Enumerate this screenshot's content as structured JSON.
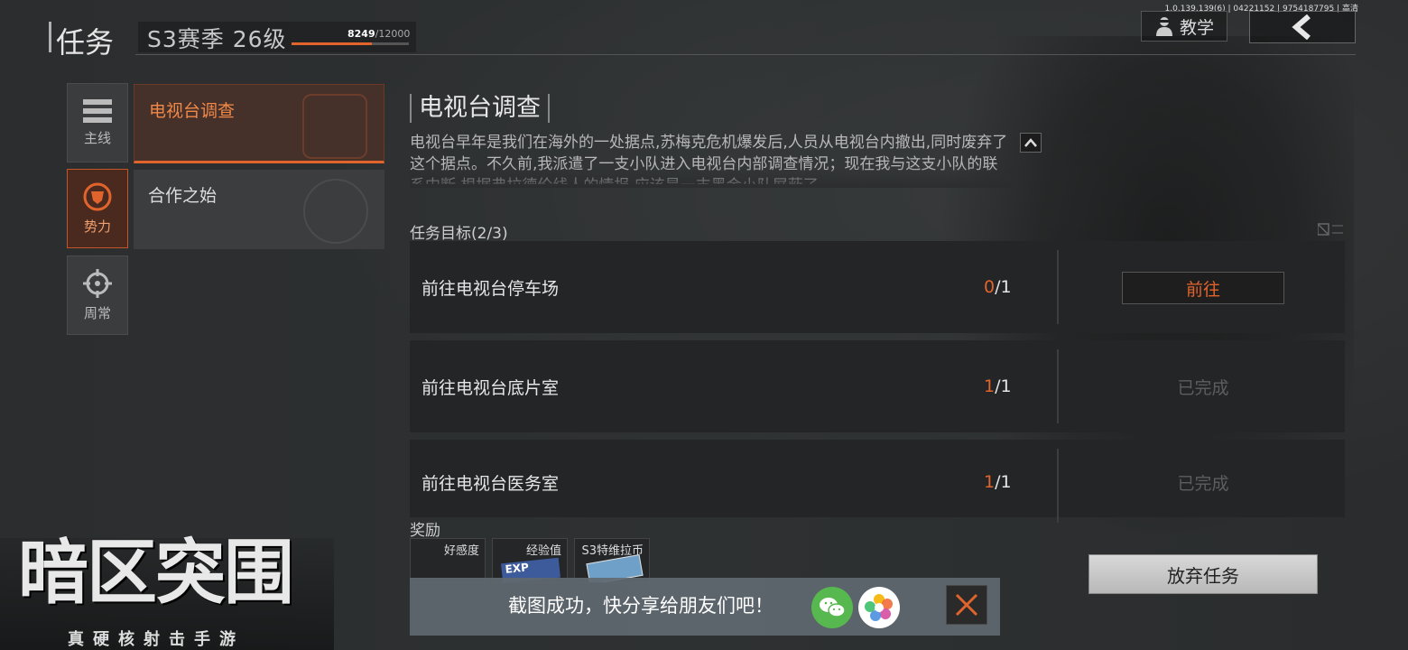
{
  "header": {
    "title": "任务",
    "season_label": "S3赛季 26级",
    "xp_current": "8249",
    "xp_max": "/12000",
    "xp_fraction": 0.687,
    "version": "1.0.139.139(6) | 04221152 | 9754187795 | 高清",
    "tutorial_label": "教学",
    "back_icon": "chevron-left-icon"
  },
  "categories": [
    {
      "label": "主线",
      "icon": "list-icon",
      "active": false
    },
    {
      "label": "势力",
      "icon": "faction-shield-icon",
      "active": true
    },
    {
      "label": "周常",
      "icon": "crosshair-icon",
      "active": false
    }
  ],
  "tasks": [
    {
      "label": "电视台调查",
      "active": true
    },
    {
      "label": "合作之始",
      "active": false
    }
  ],
  "detail": {
    "title": "电视台调查",
    "description": "电视台早年是我们在海外的一处据点,苏梅克危机爆发后,人员从电视台内撤出,同时废弃了这个据点。不久前,我派遣了一支小队进入电视台内部调查情况；现在我与这支小队的联系中断,根据弗拉德伦线人的情报,应该是一支黑金小队屏蔽了",
    "objectives_title": "任务目标(2/3)",
    "objectives": [
      {
        "label": "前往电视台停车场",
        "current": "0",
        "total": "/1",
        "action": "前往",
        "done": false
      },
      {
        "label": "前往电视台底片室",
        "current": "1",
        "total": "/1",
        "action": "已完成",
        "done": true
      },
      {
        "label": "前往电视台医务室",
        "current": "1",
        "total": "/1",
        "action": "已完成",
        "done": true
      }
    ],
    "rewards_title": "奖励",
    "rewards": [
      {
        "label": "好感度"
      },
      {
        "label": "经验值",
        "badge": "EXP"
      },
      {
        "label": "S3特维拉币"
      }
    ],
    "abandon_label": "放弃任务"
  },
  "toast": {
    "text": "截图成功，快分享给朋友们吧！",
    "wechat_icon": "wechat-icon",
    "album_icon": "photos-icon",
    "close_icon": "close-icon"
  },
  "logo": {
    "main": "暗区突围",
    "sub": "真硬核射击手游"
  },
  "colors": {
    "accent": "#e2642d",
    "panel": "#232526",
    "done_text": "#5c5e5f"
  }
}
